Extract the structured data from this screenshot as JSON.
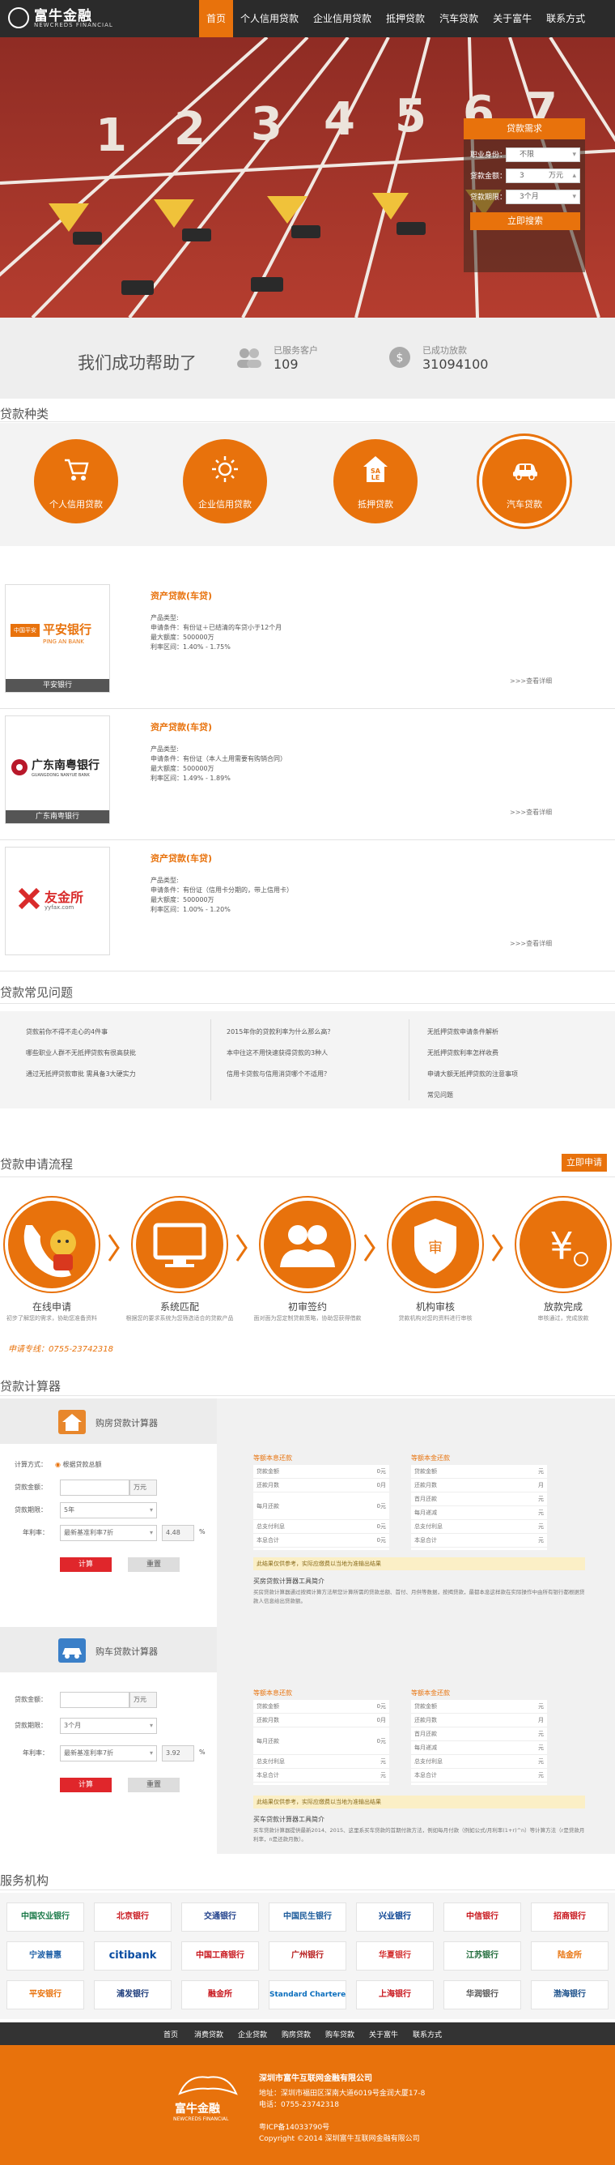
{
  "colors": {
    "accent": "#e8720c",
    "header_bg": "#2b2b2b",
    "calc_btn": "#e0262b"
  },
  "brand": {
    "name_cn": "富牛金融",
    "name_en": "NEWCREDS FINANCIAL"
  },
  "nav": [
    "首页",
    "个人信用贷款",
    "企业信用贷款",
    "抵押贷款",
    "汽车贷款",
    "关于富牛",
    "联系方式"
  ],
  "hero": {
    "lane_numbers": [
      "1",
      "2",
      "3",
      "4",
      "5",
      "6",
      "7"
    ],
    "quick": {
      "title": "贷款需求",
      "rows": [
        {
          "label": "职业身份：",
          "value": "不限",
          "unit": ""
        },
        {
          "label": "贷款金额：",
          "value": "3",
          "unit": "万元"
        },
        {
          "label": "贷款期限：",
          "value": "3个月",
          "unit": ""
        }
      ],
      "button": "立即搜索"
    }
  },
  "stats": {
    "headline": "我们成功帮助了",
    "served_label": "已服务客户",
    "served_value": "109",
    "amount_label": "已成功放款",
    "amount_value": "31094100"
  },
  "types": {
    "title": "贷款种类",
    "items": [
      "个人信用贷款",
      "企业信用贷款",
      "抵押贷款",
      "汽车贷款"
    ],
    "sale_text": [
      "SA",
      "LE"
    ]
  },
  "products": [
    {
      "bank": "平安银行",
      "bank_logo": "平安银行",
      "bank_logo_en": "PING AN BANK",
      "bank_badge": "中国平安",
      "title": "资产贷款(车贷)",
      "lines": [
        "产品类型:",
        "申请条件：有份证＋已结清的车贷小于12个月",
        "最大额度：500000万",
        "利率区间：1.40% - 1.75%"
      ],
      "more": ">>>查看详细"
    },
    {
      "bank": "广东南粤银行",
      "bank_logo": "广东南粤银行",
      "bank_logo_en": "GUANGDONG NANYUE BANK",
      "title": "资产贷款(车贷)",
      "lines": [
        "产品类型:",
        "申请条件：有份证（本人土用需要有购销合同）",
        "最大额度：500000万",
        "利率区间：1.49% - 1.89%"
      ],
      "more": ">>>查看详细"
    },
    {
      "bank": "",
      "bank_logo": "友金所",
      "bank_logo_en": "yyfax.com",
      "title": "资产贷款(车贷)",
      "lines": [
        "产品类型:",
        "申请条件：有份证（信用卡分期的，带上信用卡）",
        "最大额度：500000万",
        "利率区间：1.00% - 1.20%"
      ],
      "more": ">>>查看详细"
    }
  ],
  "faq": {
    "title": "贷款常见问题",
    "cols": [
      [
        "贷款前你不得不走心的4件事",
        "哪些职业人群不无抵押贷款有很高获批",
        "通过无抵押贷款审批 需具备3大硬实力"
      ],
      [
        "2015年你的贷款利率为什么那么高？",
        "本中往这不用快速获得贷款的3种人",
        "信用卡贷款与信用消贷哪个不适用？"
      ],
      [
        "无抵押贷款申请条件解析",
        "无抵押贷款利率怎样收费",
        "申请大额无抵押贷款的注意事项",
        "常见问题"
      ]
    ]
  },
  "process": {
    "title": "贷款申请流程",
    "apply_button": "立即申请",
    "phone": "申请专线：0755-23742318",
    "steps": [
      {
        "title": "在线申请",
        "desc": "初步了解您的需求，协助您准备资料"
      },
      {
        "title": "系统匹配",
        "desc": "根据您的要求系统为您筛选适合的贷款产品"
      },
      {
        "title": "初审签约",
        "desc": "面对面为您定制贷款策略，协助您获得借款"
      },
      {
        "title": "机构审核",
        "desc": "贷款机构对您的资料进行审核"
      },
      {
        "title": "放款完成",
        "desc": "审核通过，完成放款"
      }
    ],
    "shield_text": "审",
    "yen": "¥"
  },
  "calculator": {
    "title": "贷款计算器",
    "house": {
      "title": "购房贷款计算器",
      "method_label": "计算方式：",
      "method_value": "根据贷款总额",
      "amount_label": "贷款金额：",
      "amount_unit": "万元",
      "term_label": "贷款期限：",
      "term_value": "5年",
      "rate_label": "年利率：",
      "rate_type": "最新基准利率7折",
      "rate_value": "4.48",
      "percent": "%",
      "calc": "计算",
      "reset": "重置",
      "left_head": "等额本息还款",
      "right_head": "等额本金还款",
      "rows_left": [
        [
          "贷款金额",
          "0元"
        ],
        [
          "还款月数",
          "0月"
        ],
        [
          "每月还款",
          "0元"
        ],
        [
          "总支付利息",
          "0元"
        ],
        [
          "本息合计",
          "0元"
        ]
      ],
      "rows_right": [
        [
          "贷款金额",
          "元"
        ],
        [
          "还款月数",
          "月"
        ],
        [
          "首月还款",
          "元"
        ],
        [
          "每月递减",
          "元"
        ],
        [
          "总支付利息",
          "元"
        ],
        [
          "本息合计",
          "元"
        ]
      ],
      "note": "此结果仅供参考，实际应缴费以当地为准输出结果",
      "explain_title": "买房贷款计算器工具简介",
      "explain": "买房贷款计算器通过按揭计算方法帮您计算所需的贷款总额、首付、月供等数据，按揭贷款，最都本息这样款在实际操作中由所有银行都根据贷款人信息给出贷款额。"
    },
    "car": {
      "title": "购车贷款计算器",
      "amount_label": "贷款金额：",
      "amount_unit": "万元",
      "term_label": "贷款期限：",
      "term_value": "3个月",
      "rate_label": "年利率：",
      "rate_type": "最新基准利率7折",
      "rate_value": "3.92",
      "percent": "%",
      "calc": "计算",
      "reset": "重置",
      "left_head": "等额本息还款",
      "right_head": "等额本金还款",
      "rows_left": [
        [
          "贷款金额",
          "0元"
        ],
        [
          "还款月数",
          "0月"
        ],
        [
          "每月还款",
          "0元"
        ],
        [
          "总支付利息",
          "元"
        ],
        [
          "本息合计",
          "元"
        ]
      ],
      "rows_right": [
        [
          "贷款金额",
          "元"
        ],
        [
          "还款月数",
          "月"
        ],
        [
          "首月还款",
          "元"
        ],
        [
          "每月递减",
          "元"
        ],
        [
          "总支付利息",
          "元"
        ],
        [
          "本息合计",
          "元"
        ]
      ],
      "note": "此结果仅供参考，实际应缴费以当地为准输出结果",
      "explain_title": "买车贷款计算器工具简介",
      "explain": "买车贷款计算器提供最新2014、2015、这里系买车贷款的首期付款方法，例如每月付款（例如公式/月利率(1+r)^n）等计算方法（r是贷款月利率，n是还款月数）。"
    }
  },
  "banks": {
    "title": "服务机构",
    "items": [
      "中国农业银行",
      "北京银行",
      "交通银行",
      "中国民生银行",
      "兴业银行",
      "中信银行",
      "招商银行",
      "宁波普惠",
      "citibank",
      "中国工商银行",
      "广州银行",
      "华夏银行",
      "江苏银行",
      "陆金所",
      "平安银行",
      "浦发银行",
      "融金所",
      "Standard Chartered",
      "上海银行",
      "华润银行",
      "渤海银行"
    ]
  },
  "footer": {
    "nav": [
      "首页",
      "消费贷款",
      "企业贷款",
      "购房贷款",
      "购车贷款",
      "关于富牛",
      "联系方式"
    ],
    "company": "深圳市富牛互联网金融有限公司",
    "address": "地址：深圳市福田区深南大道6019号金润大厦17-8",
    "phone": "电话：0755-23742318",
    "icp": "粤ICP备14033790号",
    "copyright": "Copyright ©2014 深圳富牛互联网金融有限公司"
  }
}
